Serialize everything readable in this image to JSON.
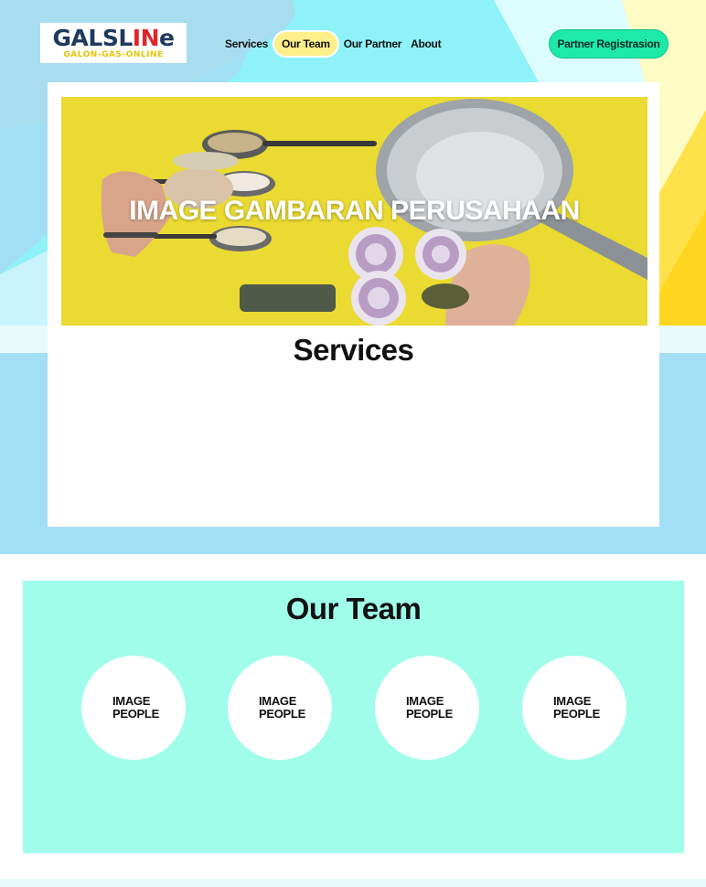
{
  "brand": {
    "logo_main_a": "GALSL",
    "logo_main_b": "IN",
    "logo_main_c": "e",
    "logo_sub": "GALON-GAS-ONLINE"
  },
  "nav": {
    "items": [
      {
        "label": "Services"
      },
      {
        "label": "Our Team",
        "active": true
      },
      {
        "label": "Our Partner"
      },
      {
        "label": "About"
      }
    ],
    "cta": "Partner Registrasion"
  },
  "hero": {
    "banner_title": "IMAGE GAMBARAN PERUSAHAAN",
    "services_title": "Services"
  },
  "team": {
    "title": "Our Team",
    "members": [
      {
        "label": "IMAGE PEOPLE"
      },
      {
        "label": "IMAGE PEOPLE"
      },
      {
        "label": "IMAGE PEOPLE"
      },
      {
        "label": "IMAGE PEOPLE"
      }
    ]
  },
  "colors": {
    "hero_bg": "#a3dff4",
    "nav_active": "#ffef8a",
    "cta": "#1de9a8",
    "team_bg": "#9ffdea",
    "banner_bg": "#eada32"
  }
}
